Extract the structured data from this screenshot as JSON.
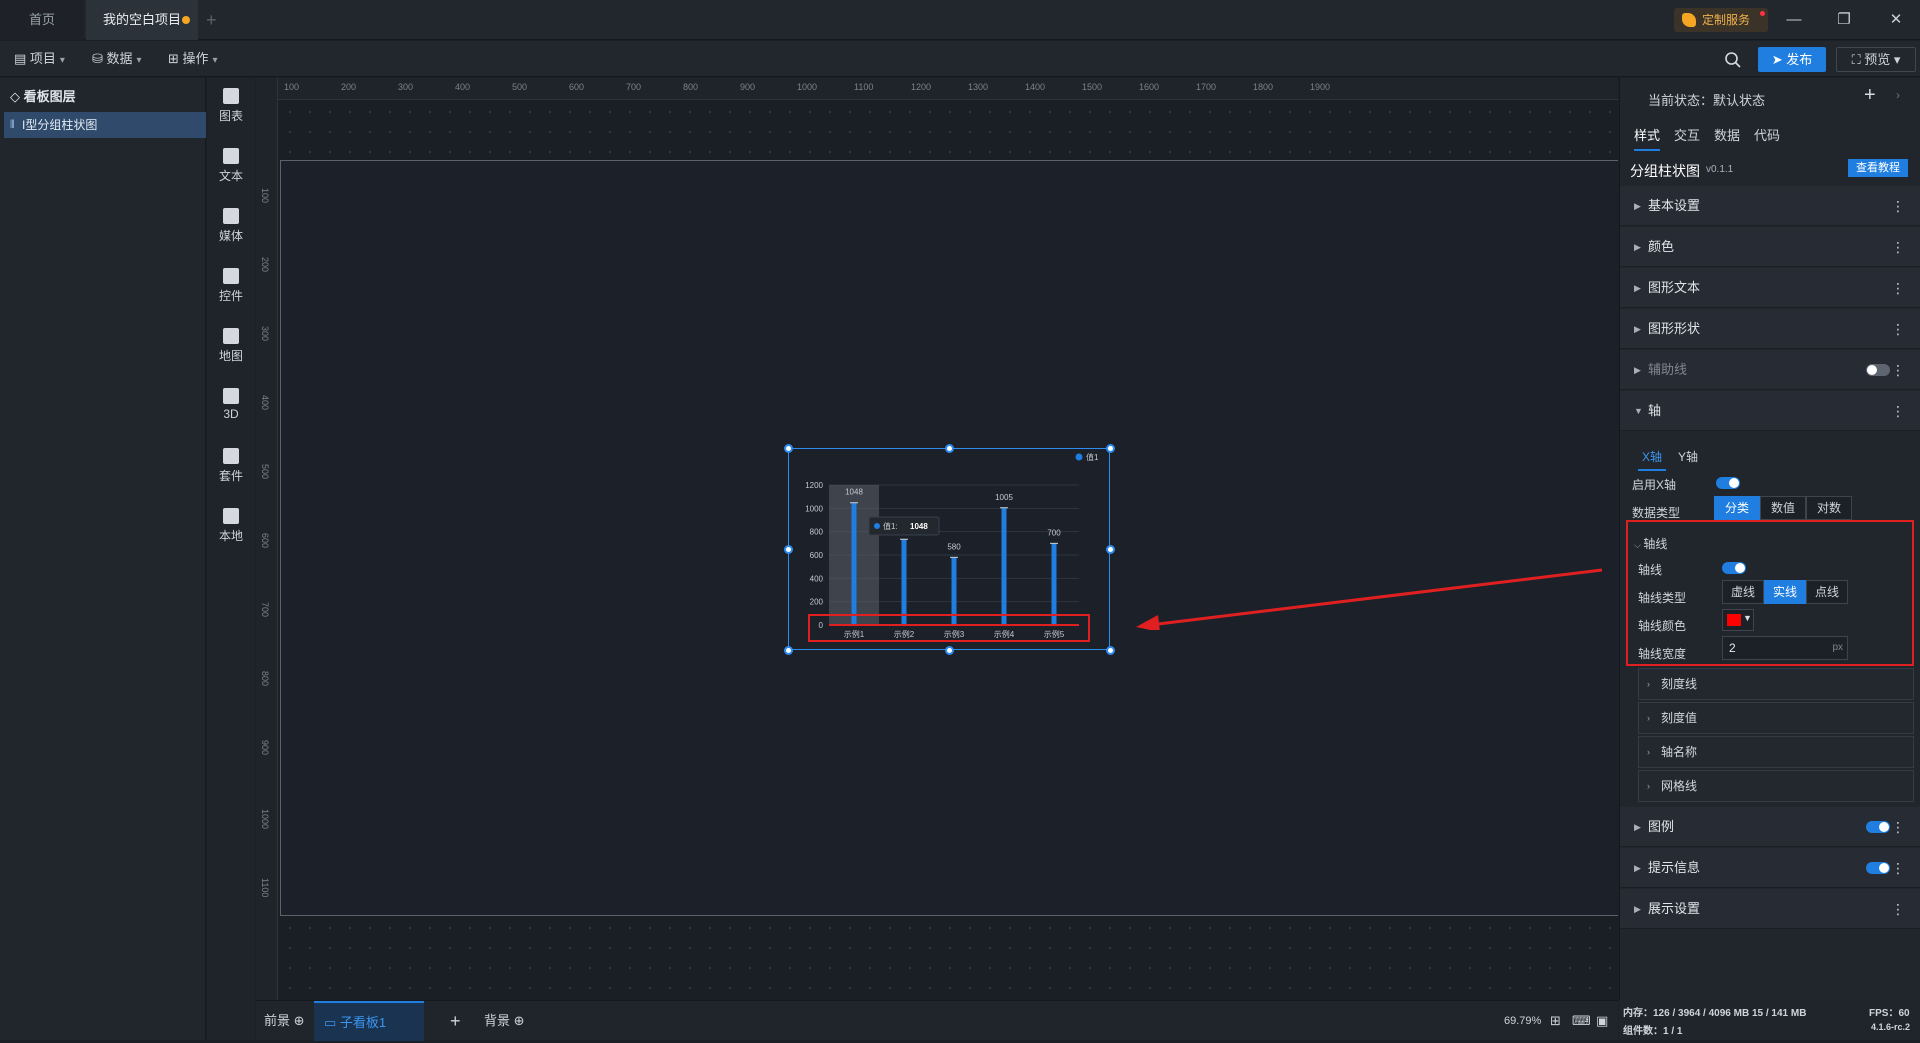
{
  "tabs": {
    "home": "首页",
    "project": "我的空白项目",
    "custom_service": "定制服务"
  },
  "toolbar": {
    "project": "项目",
    "data": "数据",
    "operate": "操作",
    "publish": "发布",
    "preview": "预览"
  },
  "layers": {
    "title": "看板图层",
    "item": "I型分组柱状图"
  },
  "components": [
    {
      "label": "图表"
    },
    {
      "label": "文本"
    },
    {
      "label": "媒体"
    },
    {
      "label": "控件"
    },
    {
      "label": "地图"
    },
    {
      "label": "3D"
    },
    {
      "label": "套件"
    },
    {
      "label": "本地"
    }
  ],
  "ruler": {
    "top": [
      "100",
      "200",
      "300",
      "400",
      "500",
      "600",
      "700",
      "800",
      "900",
      "1000",
      "1100",
      "1200",
      "1300",
      "1400",
      "1500",
      "1600",
      "1700",
      "1800",
      "1900"
    ],
    "left": [
      "100",
      "200",
      "300",
      "400",
      "500",
      "600",
      "700",
      "800",
      "900",
      "1000",
      "1100"
    ]
  },
  "chart_data": {
    "type": "bar",
    "categories": [
      "示例1",
      "示例2",
      "示例3",
      "示例4",
      "示例5"
    ],
    "series": [
      {
        "name": "值1",
        "values": [
          1048,
          735,
          580,
          1005,
          700
        ]
      }
    ],
    "data_labels": [
      "1048",
      "",
      "580",
      "1005",
      "700"
    ],
    "yticks": [
      "0",
      "200",
      "400",
      "600",
      "800",
      "1000",
      "1200"
    ],
    "ylim": [
      0,
      1200
    ],
    "tooltip": {
      "series": "值1:",
      "value": "1048"
    },
    "legend": "top-right",
    "color": "#1f7ee0",
    "axis_color": "#e02020"
  },
  "bottom": {
    "front": "前景",
    "sub_board": "子看板1",
    "background": "背景",
    "zoom": "69.79%"
  },
  "panel": {
    "state_label": "当前状态：默认状态",
    "tabs": [
      "样式",
      "交互",
      "数据",
      "代码"
    ],
    "component_name": "分组柱状图",
    "version": "v0.1.1",
    "tutorial": "查看教程",
    "sections": {
      "basic": "基本设置",
      "color": "颜色",
      "shape_text": "图形文本",
      "shape_form": "图形形状",
      "guideline": "辅助线",
      "axis": "轴",
      "legend": "图例",
      "tooltip": "提示信息",
      "display": "展示设置"
    },
    "axis": {
      "x_tab": "X轴",
      "y_tab": "Y轴",
      "enable_x": "启用X轴",
      "data_type": "数据类型",
      "data_types": [
        "分类",
        "数值",
        "对数"
      ],
      "axis_line": "轴线",
      "line": "轴线",
      "line_type": "轴线类型",
      "line_types": [
        "虚线",
        "实线",
        "点线"
      ],
      "line_color": "轴线颜色",
      "line_width": "轴线宽度",
      "width_value": "2",
      "unit": "px",
      "tick_line": "刻度线",
      "tick_value": "刻度值",
      "axis_name": "轴名称",
      "grid_line": "网格线"
    },
    "color_value": "#ff0000"
  },
  "status": {
    "memory": "内存：126 / 3964 / 4096 MB 15 / 141 MB",
    "fps": "FPS：60",
    "components": "组件数：1 / 1",
    "version": "4.1.6-rc.2"
  }
}
